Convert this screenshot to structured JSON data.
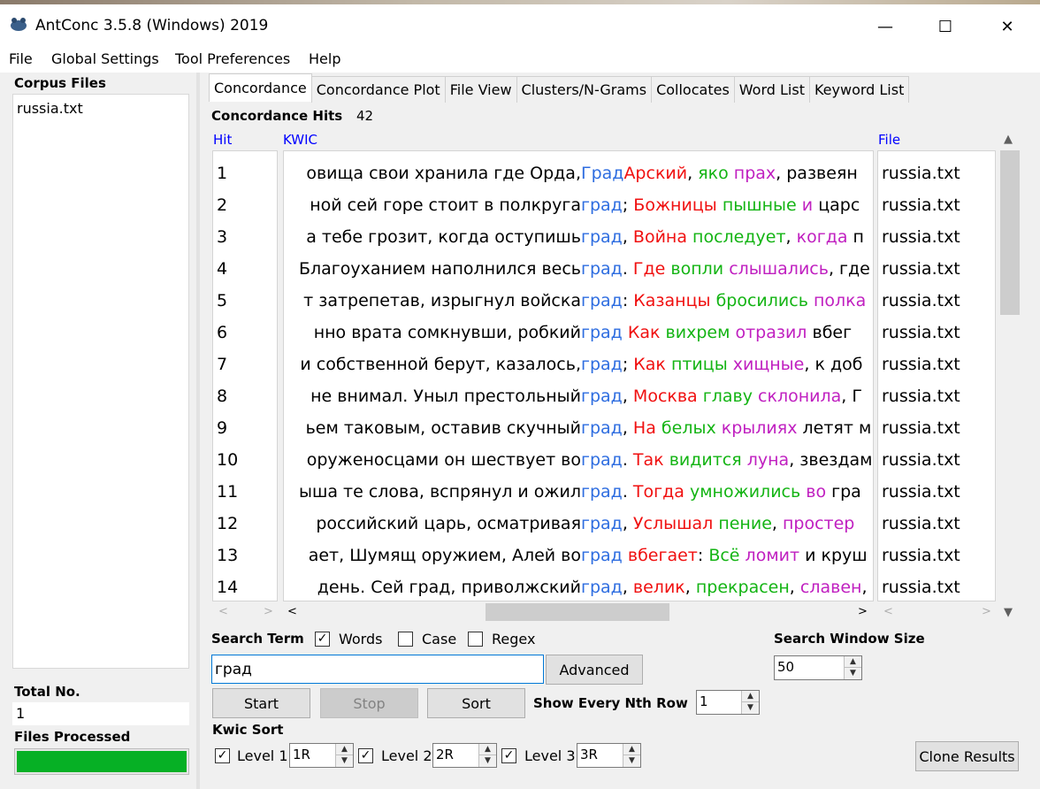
{
  "window": {
    "title": "AntConc 3.5.8 (Windows) 2019",
    "minimize_glyph": "—",
    "maximize_glyph": "☐",
    "close_glyph": "✕"
  },
  "menu": {
    "file": "File",
    "global_settings": "Global Settings",
    "tool_preferences": "Tool Preferences",
    "help": "Help"
  },
  "left_panel": {
    "corpus_files_label": "Corpus Files",
    "corpus_files": [
      "russia.txt"
    ],
    "total_no_label": "Total No.",
    "total_no_value": "1",
    "files_processed_label": "Files Processed",
    "files_processed_progress": 1.0
  },
  "tabs": [
    {
      "label": "Concordance",
      "active": true
    },
    {
      "label": "Concordance Plot",
      "active": false
    },
    {
      "label": "File View",
      "active": false
    },
    {
      "label": "Clusters/N-Grams",
      "active": false
    },
    {
      "label": "Collocates",
      "active": false
    },
    {
      "label": "Word List",
      "active": false
    },
    {
      "label": "Keyword List",
      "active": false
    }
  ],
  "concordance": {
    "hits_label": "Concordance Hits",
    "hits_count": "42",
    "col_hit": "Hit",
    "col_kwic": "KWIC",
    "col_file": "File",
    "rows": [
      {
        "hit": "1",
        "left": "овища свои хранила где Орда,",
        "kw": "Град",
        "right": [
          [
            "red",
            "Арский"
          ],
          [
            "black",
            ", "
          ],
          [
            "green",
            "яко"
          ],
          [
            "black",
            " "
          ],
          [
            "mag",
            "прах"
          ],
          [
            "black",
            ", развеян"
          ]
        ],
        "file": "russia.txt"
      },
      {
        "hit": "2",
        "left": "ной сей горе стоит в полкруга",
        "kw": "град",
        "right": [
          [
            "black",
            "; "
          ],
          [
            "red",
            "Божницы"
          ],
          [
            "black",
            " "
          ],
          [
            "green",
            "пышные"
          ],
          [
            "black",
            " "
          ],
          [
            "mag",
            "и"
          ],
          [
            "black",
            " царс"
          ]
        ],
        "file": "russia.txt"
      },
      {
        "hit": "3",
        "left": "а тебе грозит, когда оступишь",
        "kw": "град",
        "right": [
          [
            "black",
            ", "
          ],
          [
            "red",
            "Война"
          ],
          [
            "black",
            " "
          ],
          [
            "green",
            "последует"
          ],
          [
            "black",
            ", "
          ],
          [
            "mag",
            "когда"
          ],
          [
            "black",
            " п"
          ]
        ],
        "file": "russia.txt"
      },
      {
        "hit": "4",
        "left": "Благоуханием наполнился весь",
        "kw": "град",
        "right": [
          [
            "black",
            ". "
          ],
          [
            "red",
            "Где"
          ],
          [
            "black",
            " "
          ],
          [
            "green",
            "вопли"
          ],
          [
            "black",
            " "
          ],
          [
            "mag",
            "слышались"
          ],
          [
            "black",
            ", где"
          ]
        ],
        "file": "russia.txt"
      },
      {
        "hit": "5",
        "left": "т затрепетав, изрыгнул войска",
        "kw": "град",
        "right": [
          [
            "black",
            ": "
          ],
          [
            "red",
            "Казанцы"
          ],
          [
            "black",
            " "
          ],
          [
            "green",
            "бросились"
          ],
          [
            "black",
            " "
          ],
          [
            "mag",
            "полка"
          ]
        ],
        "file": "russia.txt"
      },
      {
        "hit": "6",
        "left": "нно врата сомкнувши, робкий",
        "kw": "град",
        "right": [
          [
            "black",
            "  "
          ],
          [
            "red",
            "Как"
          ],
          [
            "black",
            " "
          ],
          [
            "green",
            "вихрем"
          ],
          [
            "black",
            " "
          ],
          [
            "mag",
            "отразил"
          ],
          [
            "black",
            " вбег"
          ]
        ],
        "file": "russia.txt"
      },
      {
        "hit": "7",
        "left": "и собственной берут, казалось,",
        "kw": "град",
        "right": [
          [
            "black",
            "; "
          ],
          [
            "red",
            "Как"
          ],
          [
            "black",
            " "
          ],
          [
            "green",
            "птицы"
          ],
          [
            "black",
            " "
          ],
          [
            "mag",
            "хищные"
          ],
          [
            "black",
            ", к доб"
          ]
        ],
        "file": "russia.txt"
      },
      {
        "hit": "8",
        "left": "не внимал.  Уныл престольный",
        "kw": "град",
        "right": [
          [
            "black",
            ", "
          ],
          [
            "red",
            "Москва"
          ],
          [
            "black",
            " "
          ],
          [
            "green",
            "главу"
          ],
          [
            "black",
            " "
          ],
          [
            "mag",
            "склонила"
          ],
          [
            "black",
            ", Г"
          ]
        ],
        "file": "russia.txt"
      },
      {
        "hit": "9",
        "left": "ьем таковым, оставив скучный",
        "kw": "град",
        "right": [
          [
            "black",
            ", "
          ],
          [
            "red",
            "На"
          ],
          [
            "black",
            " "
          ],
          [
            "green",
            "белых"
          ],
          [
            "black",
            " "
          ],
          [
            "mag",
            "крылиях"
          ],
          [
            "black",
            " летят м"
          ]
        ],
        "file": "russia.txt"
      },
      {
        "hit": "10",
        "left": "оруженосцами он шествует во",
        "kw": "град",
        "right": [
          [
            "black",
            ". "
          ],
          [
            "red",
            "Так"
          ],
          [
            "black",
            " "
          ],
          [
            "green",
            "видится"
          ],
          [
            "black",
            " "
          ],
          [
            "mag",
            "луна"
          ],
          [
            "black",
            ", звездам"
          ]
        ],
        "file": "russia.txt"
      },
      {
        "hit": "11",
        "left": "ыша те слова, вспрянул и ожил",
        "kw": "град",
        "right": [
          [
            "black",
            ".  "
          ],
          [
            "red",
            "Тогда"
          ],
          [
            "black",
            " "
          ],
          [
            "green",
            "умножились"
          ],
          [
            "black",
            " "
          ],
          [
            "mag",
            "во"
          ],
          [
            "black",
            " гра"
          ]
        ],
        "file": "russia.txt"
      },
      {
        "hit": "12",
        "left": "российский царь, осматривая",
        "kw": "град",
        "right": [
          [
            "black",
            ", "
          ],
          [
            "red",
            "Услышал"
          ],
          [
            "black",
            " "
          ],
          [
            "green",
            "пение"
          ],
          [
            "black",
            ", "
          ],
          [
            "mag",
            "простер"
          ]
        ],
        "file": "russia.txt"
      },
      {
        "hit": "13",
        "left": "ает, Шумящ оружием, Алей во",
        "kw": "град",
        "right": [
          [
            "black",
            " "
          ],
          [
            "red",
            "вбегает"
          ],
          [
            "black",
            ": "
          ],
          [
            "green",
            "Всё"
          ],
          [
            "black",
            " "
          ],
          [
            "mag",
            "ломит"
          ],
          [
            "black",
            " и круш"
          ]
        ],
        "file": "russia.txt"
      },
      {
        "hit": "14",
        "left": "день.  Сей град, приволжский",
        "kw": "град",
        "right": [
          [
            "black",
            ", "
          ],
          [
            "red",
            "велик"
          ],
          [
            "black",
            ", "
          ],
          [
            "green",
            "прекрасен"
          ],
          [
            "black",
            ", "
          ],
          [
            "mag",
            "славен"
          ],
          [
            "black",
            ","
          ]
        ],
        "file": "russia.txt"
      }
    ]
  },
  "search": {
    "search_term_label": "Search Term",
    "words_label": "Words",
    "words_checked": true,
    "case_label": "Case",
    "case_checked": false,
    "regex_label": "Regex",
    "regex_checked": false,
    "term_value": "град",
    "advanced_label": "Advanced",
    "start_label": "Start",
    "stop_label": "Stop",
    "sort_label": "Sort",
    "show_every_label": "Show Every Nth Row",
    "show_every_value": "1",
    "window_size_label": "Search Window Size",
    "window_size_value": "50"
  },
  "kwic_sort": {
    "label": "Kwic Sort",
    "level1_label": "Level 1",
    "level1_value": "1R",
    "level2_label": "Level 2",
    "level2_value": "2R",
    "level3_label": "Level 3",
    "level3_value": "3R",
    "clone_label": "Clone Results"
  },
  "colors": {
    "keyword": "#2e6de0",
    "right1": "#f01010",
    "right2": "#14b414",
    "right3": "#c020c0",
    "header_blue": "#0000ff",
    "progress_green": "#06b025"
  }
}
